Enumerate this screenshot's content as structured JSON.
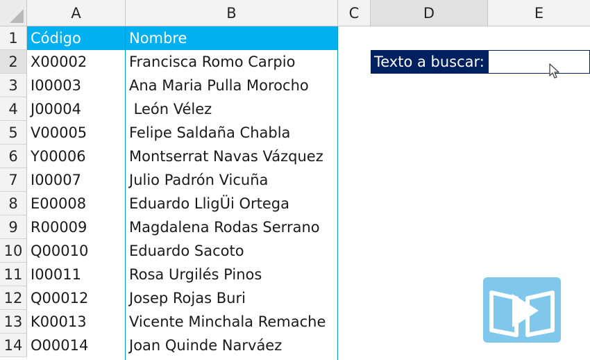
{
  "columns": [
    "A",
    "B",
    "C",
    "D",
    "E"
  ],
  "rows": [
    "1",
    "2",
    "3",
    "4",
    "5",
    "6",
    "7",
    "8",
    "9",
    "10",
    "11",
    "12",
    "13",
    "14"
  ],
  "table": {
    "header": {
      "code": "Código",
      "name": "Nombre"
    },
    "records": [
      {
        "code": "X00002",
        "name": "Francisca Romo Carpio"
      },
      {
        "code": "I00003",
        "name": "Ana Maria Pulla Morocho"
      },
      {
        "code": "J00004",
        "name": " León Vélez"
      },
      {
        "code": "V00005",
        "name": "Felipe Saldaña Chabla"
      },
      {
        "code": "Y00006",
        "name": "Montserrat Navas Vázquez"
      },
      {
        "code": "I00007",
        "name": "Julio Padrón Vicuña"
      },
      {
        "code": "E00008",
        "name": "Eduardo LligÜi Ortega"
      },
      {
        "code": "R00009",
        "name": "Magdalena Rodas Serrano"
      },
      {
        "code": "Q00010",
        "name": "Eduardo Sacoto"
      },
      {
        "code": "I00011",
        "name": "Rosa Urgilés Pinos"
      },
      {
        "code": "Q00012",
        "name": "Josep Rojas Buri"
      },
      {
        "code": "K00013",
        "name": "Vicente Minchala Remache"
      },
      {
        "code": "O00014",
        "name": "Joan Quinde Narváez"
      }
    ]
  },
  "search": {
    "label": "Texto a buscar:",
    "value": ""
  },
  "icons": {
    "cursor": "mouse-pointer-icon",
    "logo": "video-play-book-icon"
  },
  "colors": {
    "header_bg": "#00b0f0",
    "label_bg": "#002060",
    "logo": "#7fc8ec"
  }
}
